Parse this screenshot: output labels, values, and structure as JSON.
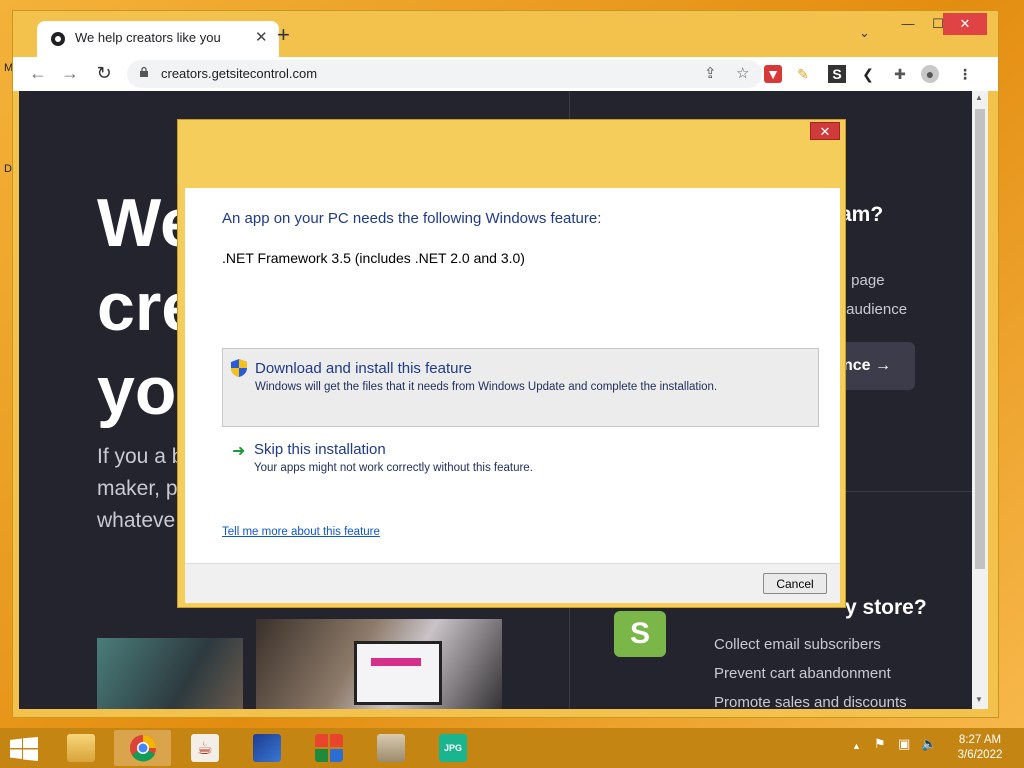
{
  "browser": {
    "tab_title": "We help creators like you",
    "new_tab_glyph": "+",
    "tab_close_glyph": "✕",
    "url": "creators.getsitecontrol.com",
    "window_controls": {
      "minimize": "—",
      "maximize": "☐",
      "close": "✕"
    }
  },
  "webpage": {
    "hero_lines": [
      "We help",
      "creators like",
      "you"
    ],
    "sub_lines": [
      "If you a b",
      "maker, pl",
      "whateve"
    ],
    "right_heading": "gram?",
    "right_lines": [
      "ing page",
      "r audience"
    ],
    "right_button": "nce →",
    "store_heading": "y store?",
    "store_lines": [
      "Collect email subscribers",
      "Prevent cart abandonment",
      "Promote sales and discounts"
    ],
    "shopify_letter": "S"
  },
  "dialog": {
    "heading": "An app on your PC needs the following Windows feature:",
    "feature": ".NET Framework 3.5 (includes .NET 2.0 and 3.0)",
    "option1_title": "Download and install this feature",
    "option1_desc": "Windows will get the files that it needs from Windows Update and complete the installation.",
    "option2_title": "Skip this installation",
    "option2_desc": "Your apps might not work correctly without this feature.",
    "link": "Tell me more about this feature",
    "cancel": "Cancel",
    "close_glyph": "✕"
  },
  "taskbar": {
    "time": "8:27 AM",
    "date": "3/6/2022",
    "tray_up_glyph": "▲"
  },
  "colors": {
    "accent_yellow": "#f2c24d",
    "page_dark": "#24242f",
    "dialog_heading": "#1e3a8a",
    "close_red": "#e04343",
    "shopify_green": "#7ab648"
  }
}
